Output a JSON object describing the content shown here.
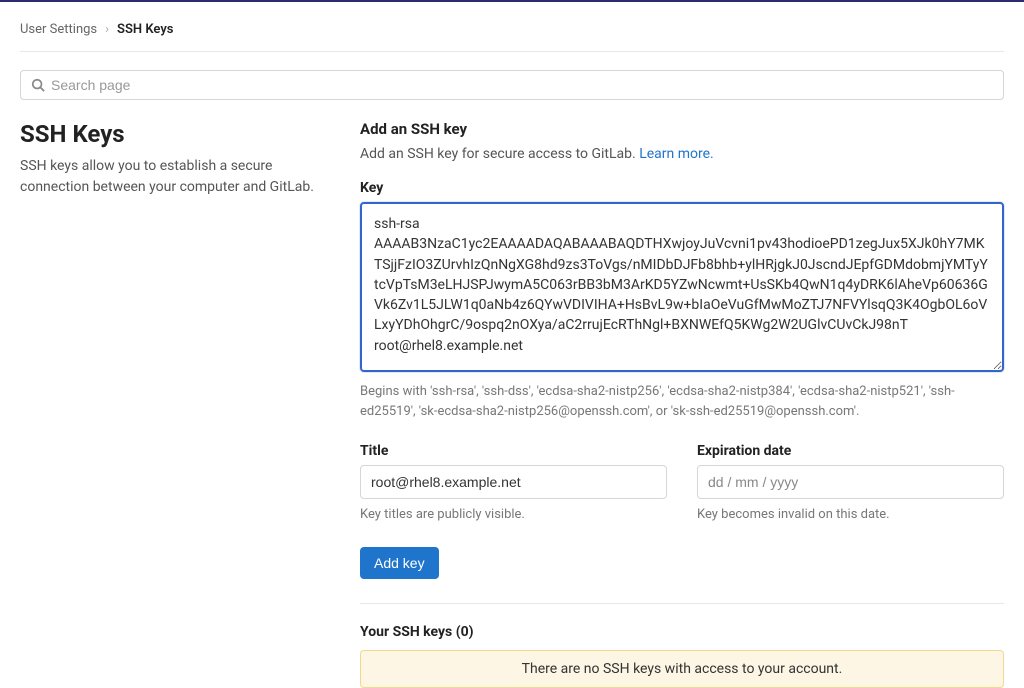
{
  "breadcrumb": {
    "parent": "User Settings",
    "separator": "›",
    "current": "SSH Keys"
  },
  "search": {
    "placeholder": "Search page"
  },
  "left": {
    "title": "SSH Keys",
    "description": "SSH keys allow you to establish a secure connection between your computer and GitLab."
  },
  "add": {
    "heading": "Add an SSH key",
    "subtext_prefix": "Add an SSH key for secure access to GitLab. ",
    "learn_more": "Learn more.",
    "key_label": "Key",
    "key_value": "ssh-rsa AAAAB3NzaC1yc2EAAAADAQABAAABAQDTHXwjoyJuVcvni1pv43hodioePD1zegJux5XJk0hY7MKTSjjFzIO3ZUrvhIzQnNgXG8hd9zs3ToVgs/nMIDbDJFb8bhb+ylHRjgkJ0JscndJEpfGDMdobmjYMTyYtcVpTsM3eLHJSPJwymA5C063rBB3bM3ArKD5YZwNcwmt+UsSKb4QwN1q4yDRK6lAheVp60636GVk6Zv1L5JLW1q0aNb4z6QYwVDIVIHA+HsBvL9w+bIaOeVuGfMwMoZTJ7NFVYlsqQ3K4OgbOL6oVLxyYDhOhgrC/9ospq2nOXya/aC2rrujEcRThNgl+BXNWEfQ5KWg2W2UGlvCUvCkJ98nT root@rhel8.example.net",
    "key_helper": "Begins with 'ssh-rsa', 'ssh-dss', 'ecdsa-sha2-nistp256', 'ecdsa-sha2-nistp384', 'ecdsa-sha2-nistp521', 'ssh-ed25519', 'sk-ecdsa-sha2-nistp256@openssh.com', or 'sk-ssh-ed25519@openssh.com'.",
    "title_label": "Title",
    "title_value": "root@rhel8.example.net",
    "title_helper": "Key titles are publicly visible.",
    "expiration_label": "Expiration date",
    "expiration_placeholder": "dd / mm / yyyy",
    "expiration_helper": "Key becomes invalid on this date.",
    "button": "Add key"
  },
  "your_keys": {
    "heading": "Your SSH keys (0)",
    "empty": "There are no SSH keys with access to your account."
  }
}
